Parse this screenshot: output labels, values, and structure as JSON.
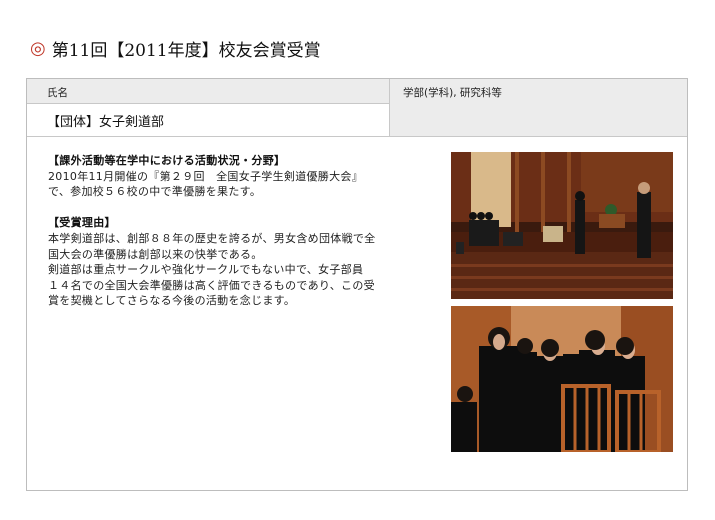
{
  "page": {
    "title_mark": "◎",
    "title": "第11回【2011年度】校友会賞受賞"
  },
  "table": {
    "header_name": "氏名",
    "header_affiliation": "学部(学科), 研究科等",
    "name_value": "【団体】女子剣道部",
    "affiliation_value": ""
  },
  "content": {
    "section1_heading": "【課外活動等在学中における活動状況・分野】",
    "section1_lines": [
      "2010年11月開催の『第２９回　全国女子学生剣道優勝大会』",
      "で、参加校５６校の中で準優勝を果たす。"
    ],
    "section2_heading": "【受賞理由】",
    "section2_lines": [
      "本学剣道部は、創部８８年の歴史を誇るが、男女含め団体戦で全",
      "国大会の準優勝は創部以来の快挙である。",
      "剣道部は重点サークルや強化サークルでもない中で、女子部員",
      "１４名での全国大会準優勝は高く評価できるものであり、この受",
      "賞を契機としてさらなる今後の活動を念じます。"
    ]
  },
  "photos": [
    {
      "subject": "award-ceremony-stage-photo"
    },
    {
      "subject": "club-members-standing-photo"
    }
  ],
  "colors": {
    "title_mark": "#c0392b",
    "header_bg": "#ececec",
    "border": "#bdbdbd"
  }
}
